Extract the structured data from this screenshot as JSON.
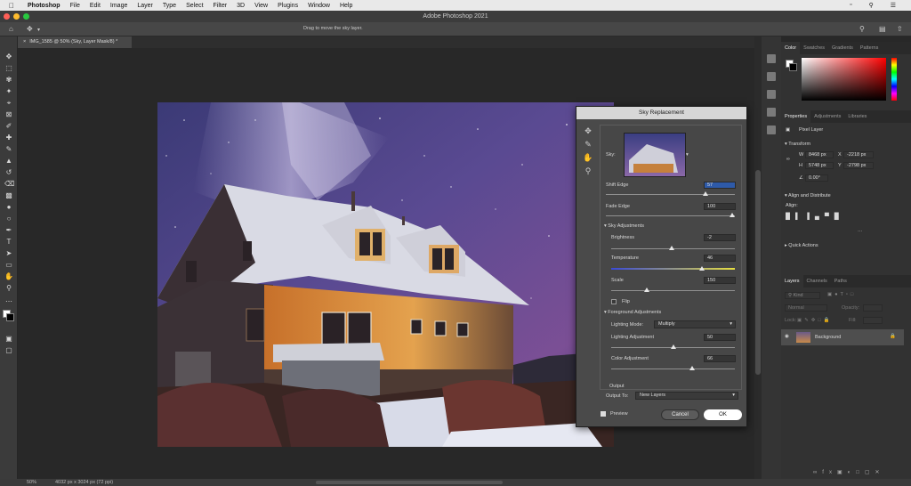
{
  "menubar": {
    "app": "Photoshop",
    "items": [
      "File",
      "Edit",
      "Image",
      "Layer",
      "Type",
      "Select",
      "Filter",
      "3D",
      "View",
      "Plugins",
      "Window",
      "Help"
    ]
  },
  "window": {
    "title": "Adobe Photoshop 2021"
  },
  "options": {
    "hint": "Drag to move the sky layer."
  },
  "document_tab": {
    "label": "IMG_1585 @ 50% (Sky, Layer Mask/8) *"
  },
  "status": {
    "zoom": "50%",
    "dimensions": "4032 px x 3024 px (72 ppi)"
  },
  "dialog": {
    "title": "Sky Replacement",
    "sky_label": "Sky:",
    "shift_edge_label": "Shift Edge",
    "shift_edge_value": "57",
    "fade_edge_label": "Fade Edge",
    "fade_edge_value": "100",
    "sky_adjustments_label": "Sky Adjustments",
    "brightness_label": "Brightness",
    "brightness_value": "-2",
    "temperature_label": "Temperature",
    "temperature_value": "46",
    "scale_label": "Scale",
    "scale_value": "150",
    "flip_label": "Flip",
    "foreground_label": "Foreground Adjustments",
    "lighting_mode_label": "Lighting Mode:",
    "lighting_mode_value": "Multiply",
    "lighting_adjustment_label": "Lighting Adjustment",
    "lighting_adjustment_value": "50",
    "color_adjustment_label": "Color Adjustment",
    "color_adjustment_value": "66",
    "output_label": "Output",
    "output_to_label": "Output To:",
    "output_to_value": "New Layers",
    "preview_label": "Preview",
    "cancel_label": "Cancel",
    "ok_label": "OK"
  },
  "color_panel": {
    "tabs": [
      "Color",
      "Swatches",
      "Gradients",
      "Patterns"
    ]
  },
  "properties_panel": {
    "tabs": [
      "Properties",
      "Adjustments",
      "Libraries"
    ],
    "layer_type": "Pixel Layer",
    "transform_label": "Transform",
    "w_label": "W",
    "w_value": "8468 px",
    "x_label": "X",
    "x_value": "-2218 px",
    "h_label": "H",
    "h_value": "5748 px",
    "y_label": "Y",
    "y_value": "-2798 px",
    "angle_value": "0.00°",
    "align_label": "Align and Distribute",
    "align_sub": "Align:",
    "quick_actions_label": "Quick Actions"
  },
  "layers_panel": {
    "tabs": [
      "Layers",
      "Channels",
      "Paths"
    ],
    "kind_label": "Kind",
    "blend_mode": "Normal",
    "opacity_label": "Opacity:",
    "lock_label": "Lock:",
    "fill_label": "Fill:",
    "layer_name": "Background"
  }
}
